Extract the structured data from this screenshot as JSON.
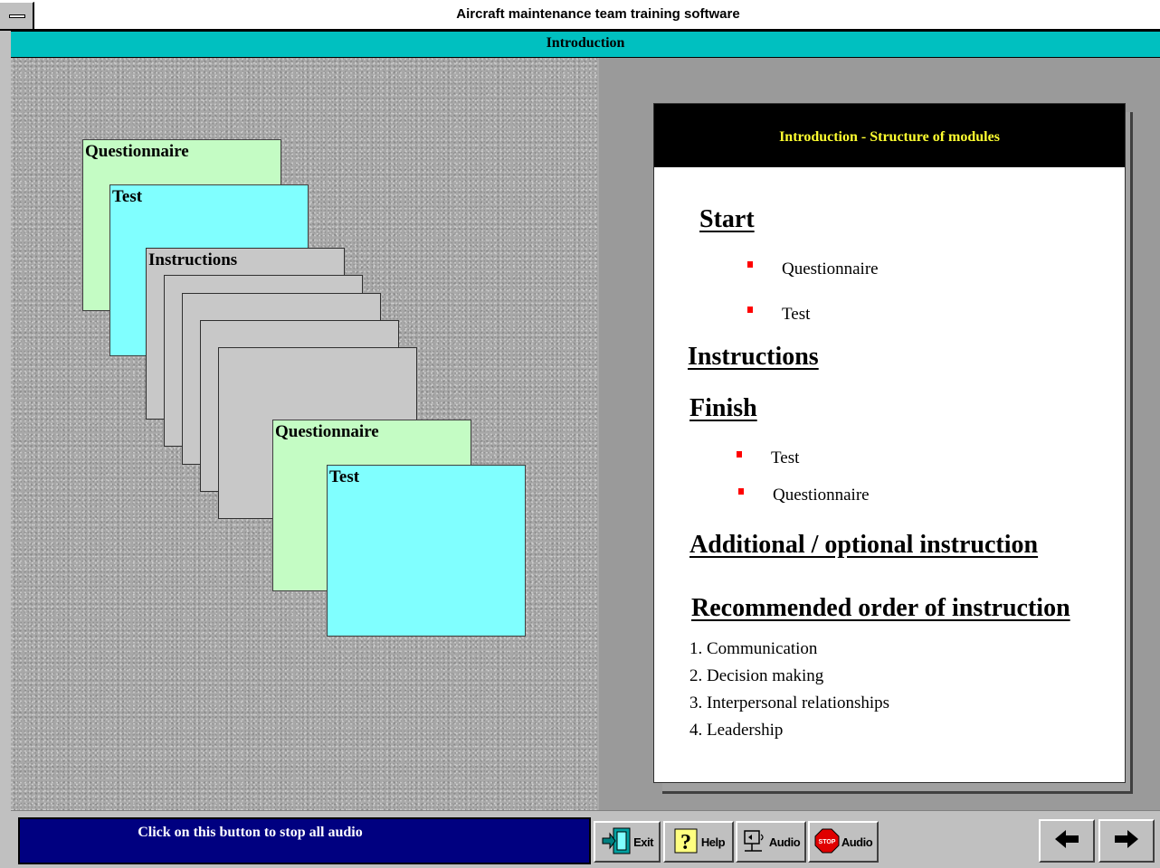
{
  "window": {
    "title": "Aircraft maintenance team training software",
    "section": "Introduction"
  },
  "diagram": {
    "cards": [
      {
        "label": "Questionnaire",
        "color": "#c4fcc4"
      },
      {
        "label": "Test",
        "color": "#80ffff"
      },
      {
        "label": "Instructions",
        "color": "#c8c8c8"
      },
      {
        "label": "Questionnaire",
        "color": "#c4fcc4"
      },
      {
        "label": "Test",
        "color": "#80ffff"
      }
    ]
  },
  "document": {
    "title": "Introduction - Structure of modules",
    "start_heading": "Start",
    "start_items": [
      "Questionnaire",
      "Test"
    ],
    "instructions_heading": "Instructions",
    "finish_heading": "Finish",
    "finish_items": [
      "Test",
      "Questionnaire"
    ],
    "additional_heading": "Additional / optional instruction",
    "recommended_heading": "Recommended order of instruction",
    "recommended_items": [
      "1. Communication",
      "2. Decision making",
      "3. Interpersonal relationships",
      "4. Leadership"
    ]
  },
  "status_bar": {
    "message": "Click on this button to stop all audio"
  },
  "toolbar": {
    "exit_label": "Exit",
    "help_label": "Help",
    "audio_label": "Audio",
    "stop_audio_label": "Audio",
    "stop_icon_text": "STOP"
  },
  "colors": {
    "accent_teal": "#00c0c0",
    "status_navy": "#000080",
    "doc_title_yellow": "#ffff30",
    "bullet_red": "#ff0000"
  }
}
